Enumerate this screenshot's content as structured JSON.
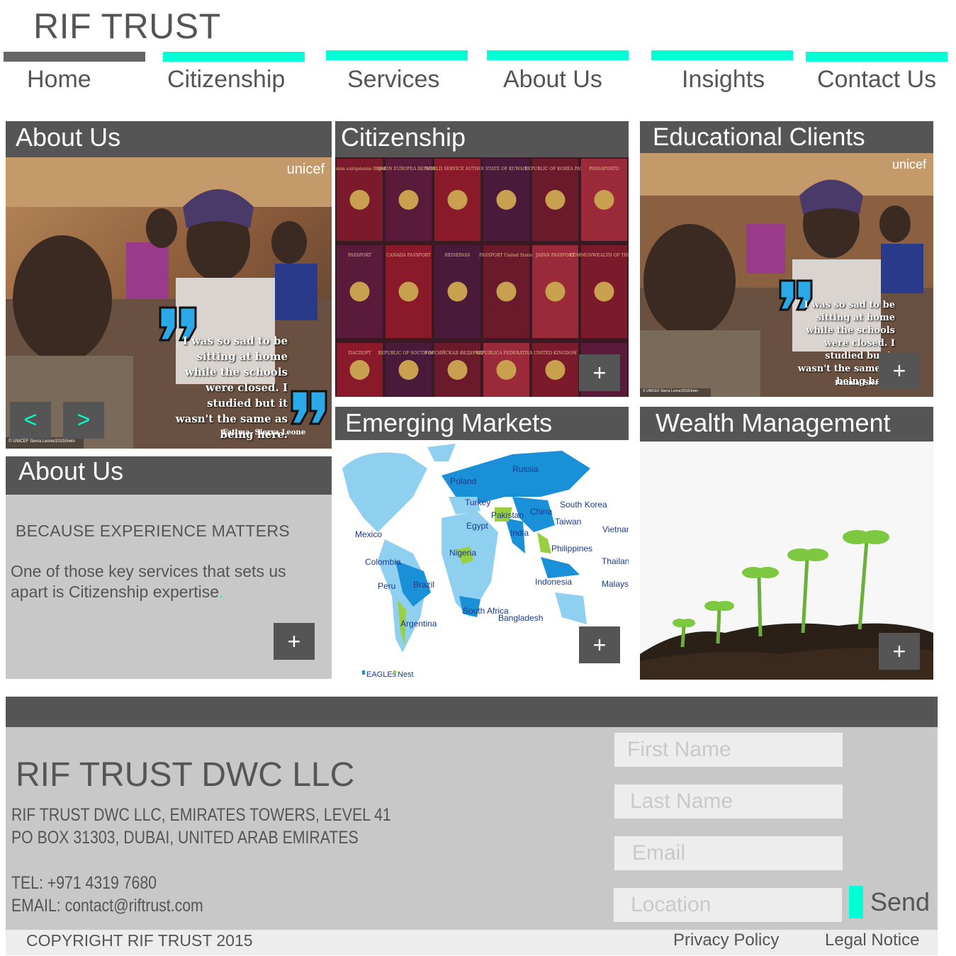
{
  "brand": "RIF TRUST",
  "colors": {
    "accent": "#00ffd5",
    "active_bar": "#666666",
    "panel": "#555555",
    "grey_bg": "#c8c8c8"
  },
  "nav": [
    {
      "label": "Home",
      "active": true
    },
    {
      "label": "Citizenship",
      "active": false
    },
    {
      "label": "Services",
      "active": false
    },
    {
      "label": "About Us",
      "active": false
    },
    {
      "label": "Insights",
      "active": false
    },
    {
      "label": "Contact Us",
      "active": false
    }
  ],
  "tiles": {
    "about_top": {
      "title": "About Us",
      "prev": "<",
      "next": ">"
    },
    "citizenship": {
      "title": "Citizenship",
      "plus": "+"
    },
    "educational": {
      "title": "Educational Clients",
      "plus": "+"
    },
    "emerging": {
      "title": "Emerging Markets",
      "plus": "+"
    },
    "wealth": {
      "title": "Wealth Management",
      "plus": "+"
    },
    "about_bottom": {
      "title": "About Us",
      "tagline": "BECAUSE EXPERIENCE MATTERS",
      "body": "One of those key services that sets us apart is Citizenship expertise",
      "plus": "+"
    }
  },
  "unicef": {
    "logo": "unicef",
    "quote": "I was so sad to be sitting at home while the schools were closed. I studied but it wasn't the same as being here.",
    "attribution": "Fatima, Sierra Leone",
    "credit": "© UNICEF Sierra Leone/2015/Irwin"
  },
  "passports": [
    "Union européenne République française",
    "UNION EUROPEA REPUBBLICA ITALIANA",
    "WORLD SERVICE AUTHORITY",
    "STATE OF KUWAIT",
    "REPUBLIC OF KOREA PASSPORT",
    "PASSAPORTO",
    "PASSPORT",
    "CANADA PASSPORT",
    "REISEPASS",
    "PASSPORT United States of America",
    "JAPAN PASSPORT",
    "COMMONWEALTH OF THE BAHAMAS",
    "ПАСПОРТ",
    "REPUBLIC OF SOUTH AFRICA",
    "РОССИЙСКАЯ ФЕДЕРАЦИЯ",
    "REPUBLICA FEDERATIVA DO BRASIL",
    "UNITED KINGDOM"
  ],
  "map_labels": [
    "Russia",
    "Poland",
    "Turkey",
    "Egypt",
    "Pakistan",
    "China",
    "South Korea",
    "Taiwan",
    "Vietnam",
    "India",
    "Philippines",
    "Thailand",
    "Mexico",
    "Nigeria",
    "Malaysia",
    "Indonesia",
    "Colombia",
    "Peru",
    "Brazil",
    "South Africa",
    "Bangladesh",
    "Argentina"
  ],
  "map_legend": {
    "eagles": "EAGLEs",
    "nest": "Nest"
  },
  "contact": {
    "company": "RIF TRUST DWC LLC",
    "address_1": "RIF TRUST DWC LLC, EMIRATES TOWERS, LEVEL 41",
    "address_2": "PO BOX 31303, DUBAI, UNITED ARAB EMIRATES",
    "tel": "TEL: +971 4319 7680",
    "email": "EMAIL: contact@riftrust.com"
  },
  "form": {
    "first_name": "First Name",
    "last_name": "Last Name",
    "email": "Email",
    "location": "Location",
    "send": "Send"
  },
  "footer": {
    "copyright": "COPYRIGHT RIF TRUST 2015",
    "privacy": "Privacy Policy",
    "legal": "Legal Notice"
  }
}
